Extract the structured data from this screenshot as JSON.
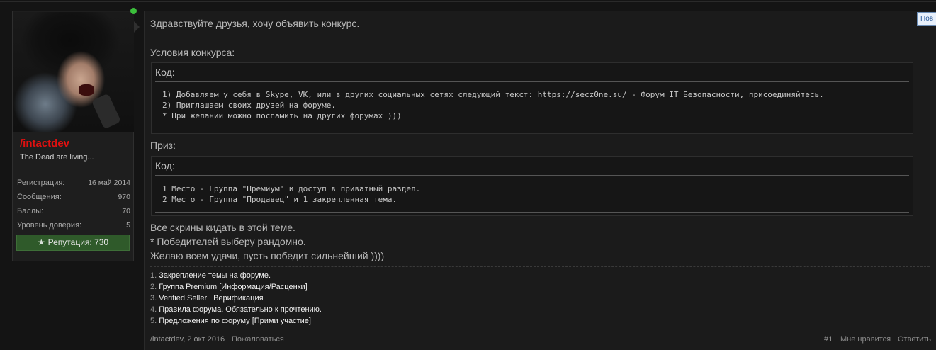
{
  "user": {
    "name": "/intactdev",
    "title": "The Dead are living...",
    "stats": [
      {
        "label": "Регистрация:",
        "value": "16 май 2014"
      },
      {
        "label": "Сообщения:",
        "value": "970"
      },
      {
        "label": "Баллы:",
        "value": "70"
      },
      {
        "label": "Уровень доверия:",
        "value": "5"
      }
    ],
    "reputation_label": "Репутация:",
    "reputation_value": "730"
  },
  "post": {
    "greeting": "Здравствуйте друзья, хочу объявить конкурс.",
    "conditions_label": "Условия конкурса:",
    "code1": {
      "head": "Код:",
      "lines": [
        "1) Добавляем у себя в Skype, VK, или в других социальных сетях следующий текст: https://secz0ne.su/ - Форум IT Безопасности, присоединяйтесь.",
        "2) Приглашаем своих друзей на форуме.",
        "* При желании можно поспамить на других форумах )))"
      ]
    },
    "prize_label": "Приз:",
    "code2": {
      "head": "Код:",
      "lines": [
        "1 Место - Группа \"Премиум\" и доступ в приватный раздел.",
        "2 Место - Группа \"Продавец\" и 1 закрепленная тема."
      ]
    },
    "closing": [
      "Все скрины кидать в этой теме.",
      "* Победителей выберу рандомно.",
      "Желаю всем удачи, пусть победит сильнейший ))))"
    ]
  },
  "signature": [
    {
      "num": "1.",
      "text": "Закрепление темы на форуме."
    },
    {
      "num": "2.",
      "text": "Группа Premium [Информация/Расценки]"
    },
    {
      "num": "3.",
      "text": "Verified Seller | Верификация"
    },
    {
      "num": "4.",
      "text": "Правила форума. Обязательно к прочтению."
    },
    {
      "num": "5.",
      "text": "Предложения по форуму [Прими участие]"
    }
  ],
  "footer": {
    "author_date": "/intactdev, 2 окт 2016",
    "report": "Пожаловаться",
    "post_number": "#1",
    "like": "Мне нравится",
    "reply": "Ответить"
  },
  "new_badge": "Нов",
  "colors": {
    "username": "#e01010",
    "reputation_bg": "#2f5a2a",
    "online": "#3bbf3b"
  }
}
